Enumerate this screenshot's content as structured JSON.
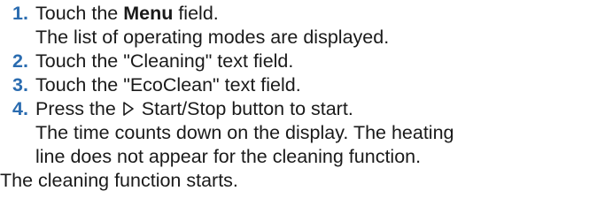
{
  "steps": [
    {
      "number": "1.",
      "text_before": "Touch the ",
      "bold": "Menu",
      "text_after": " field.",
      "result": "The list of operating modes are displayed."
    },
    {
      "number": "2.",
      "text": "Touch the \"Cleaning\" text field."
    },
    {
      "number": "3.",
      "text": "Touch the \"EcoClean\" text field."
    },
    {
      "number": "4.",
      "text_before": "Press the ",
      "icon": "play-outline-icon",
      "text_after": " Start/Stop button to start.",
      "result_lines": [
        "The time counts down on the display. The heating",
        "line does not appear for the cleaning function."
      ]
    }
  ],
  "final_result": "The cleaning function starts.",
  "colors": {
    "step_number": "#2b6cb0",
    "text": "#1a1a1a",
    "background": "#ffffff"
  }
}
